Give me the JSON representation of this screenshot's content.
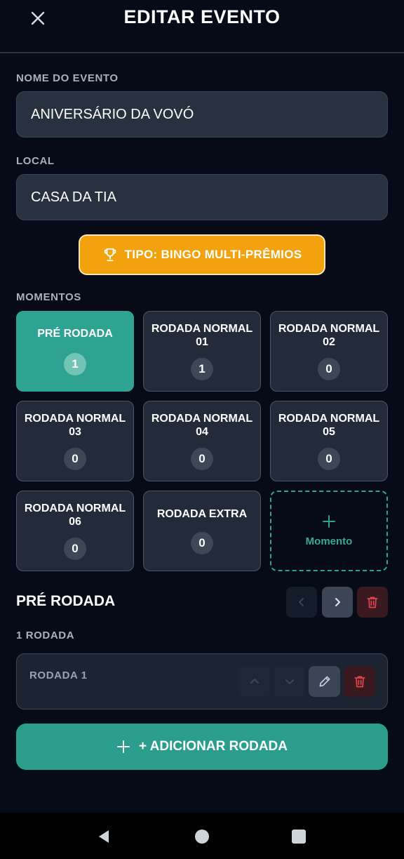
{
  "header": {
    "title": "EDITAR EVENTO",
    "close_icon": "close-icon"
  },
  "form": {
    "name_label": "NOME DO EVENTO",
    "name_value": "ANIVERSÁRIO DA VOVÓ",
    "location_label": "LOCAL",
    "location_value": "CASA DA TIA",
    "type_badge": "TIPO: BINGO MULTI-PRÊMIOS",
    "type_icon": "trophy-icon"
  },
  "moments": {
    "label": "MOMENTOS",
    "items": [
      {
        "label": "PRÉ RODADA",
        "count": "1",
        "active": true
      },
      {
        "label": "RODADA NORMAL 01",
        "count": "1",
        "active": false
      },
      {
        "label": "RODADA NORMAL 02",
        "count": "0",
        "active": false
      },
      {
        "label": "RODADA NORMAL 03",
        "count": "0",
        "active": false
      },
      {
        "label": "RODADA NORMAL 04",
        "count": "0",
        "active": false
      },
      {
        "label": "RODADA NORMAL 05",
        "count": "0",
        "active": false
      },
      {
        "label": "RODADA NORMAL 06",
        "count": "0",
        "active": false
      },
      {
        "label": "RODADA EXTRA",
        "count": "0",
        "active": false
      }
    ],
    "add_label": "Momento"
  },
  "selected": {
    "title": "PRÉ RODADA",
    "rounds_count": "1 RODADA",
    "rounds": [
      {
        "name": "RODADA 1"
      }
    ],
    "add_round_label": "+ ADICIONAR RODADA"
  },
  "colors": {
    "accent": "#2ea391",
    "badge": "#f2a20c",
    "danger": "#e0474c",
    "background": "#070a17"
  }
}
